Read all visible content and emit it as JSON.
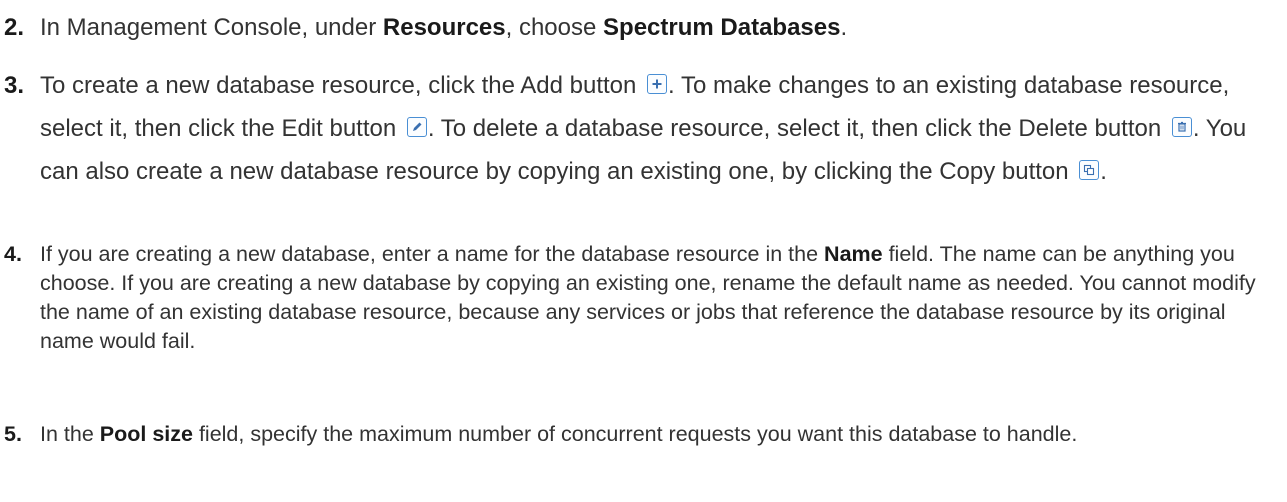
{
  "steps": [
    {
      "num": "2.",
      "p1": "In Management Console, under ",
      "b1": "Resources",
      "p2": ", choose ",
      "b2": "Spectrum Databases",
      "p3": "."
    },
    {
      "num": "3.",
      "p1": "To create a new database resource, click the Add button ",
      "p2": ". To make changes to an existing database resource, select it, then click the Edit button ",
      "p3": ". To delete a database resource, select it, then click the Delete button ",
      "p4": ". You can also create a new database resource by copying an existing one, by clicking the Copy button ",
      "p5": "."
    },
    {
      "num": "4.",
      "p1": "If you are creating a new database, enter a name for the database resource in the ",
      "b1": "Name",
      "p2": " field. The name can be anything you choose. If you are creating a new database by copying an existing one, rename the default name as needed. You cannot modify the name of an existing database resource, because any services or jobs that reference the database resource by its original name would fail."
    },
    {
      "num": "5.",
      "p1": "In the ",
      "b1": "Pool size",
      "p2": " field, specify the maximum number of concurrent requests you want this database to handle."
    }
  ],
  "icons": {
    "add": "add-icon",
    "edit": "edit-icon",
    "delete": "delete-icon",
    "copy": "copy-icon",
    "border_color": "#4a8fd4"
  }
}
